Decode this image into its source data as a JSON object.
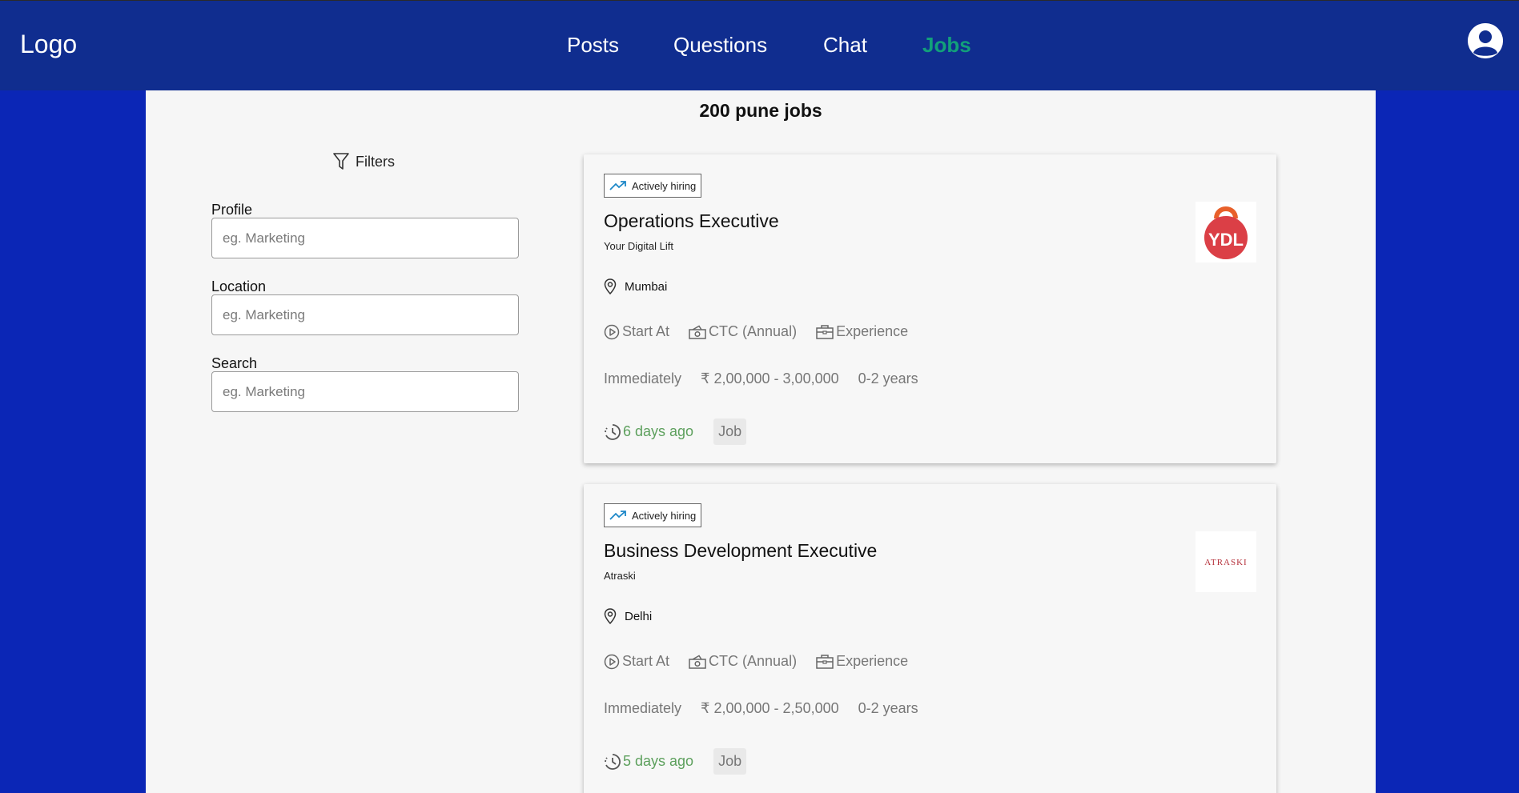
{
  "header": {
    "logo": "Logo",
    "nav": [
      {
        "label": "Posts",
        "active": false
      },
      {
        "label": "Questions",
        "active": false
      },
      {
        "label": "Chat",
        "active": false
      },
      {
        "label": "Jobs",
        "active": true
      }
    ],
    "avatar_icon": "user-avatar-icon"
  },
  "page": {
    "heading": "200 pune jobs"
  },
  "filters": {
    "title": "Filters",
    "fields": [
      {
        "label": "Profile",
        "placeholder": "eg. Marketing"
      },
      {
        "label": "Location",
        "placeholder": "eg. Marketing"
      },
      {
        "label": "Search",
        "placeholder": "eg. Marketing"
      }
    ]
  },
  "colors": {
    "page_bg": "#0b26b6",
    "header_bg": "#102d8f",
    "active_nav": "#12a07a",
    "posted_text": "#5da05d"
  },
  "jobs": [
    {
      "badge": "Actively hiring",
      "title": "Operations Executive",
      "company": "Your Digital Lift",
      "logo_text": "YDL",
      "location": "Mumbai",
      "labels": {
        "start": "Start At",
        "ctc": "CTC (Annual)",
        "experience": "Experience"
      },
      "start": "Immediately",
      "ctc": "₹ 2,00,000 - 3,00,000",
      "experience": "0-2 years",
      "posted": "6 days ago",
      "type": "Job"
    },
    {
      "badge": "Actively hiring",
      "title": "Business Development Executive",
      "company": "Atraski",
      "logo_text": "ATRASKI",
      "location": "Delhi",
      "labels": {
        "start": "Start At",
        "ctc": "CTC (Annual)",
        "experience": "Experience"
      },
      "start": "Immediately",
      "ctc": "₹ 2,00,000 - 2,50,000",
      "experience": "0-2 years",
      "posted": "5 days ago",
      "type": "Job"
    }
  ]
}
